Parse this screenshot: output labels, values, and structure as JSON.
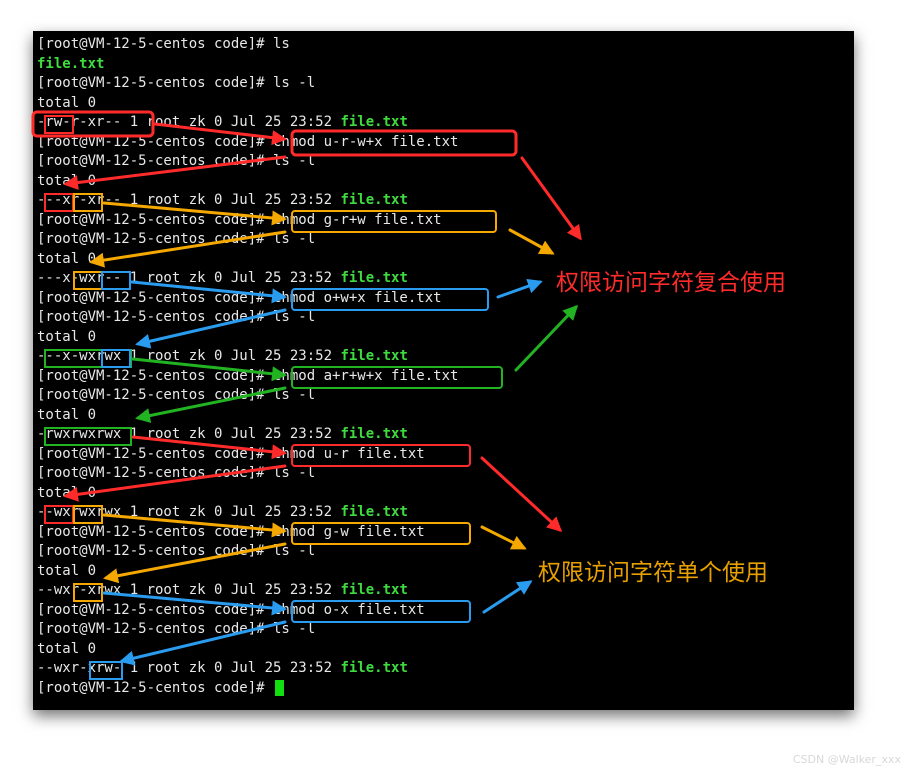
{
  "terminal": {
    "lines": [
      {
        "text": "[root@VM-12-5-centos code]# ls"
      },
      {
        "text": "",
        "file": "file.txt"
      },
      {
        "text": "[root@VM-12-5-centos code]# ls -l"
      },
      {
        "text": "total 0"
      },
      {
        "text": "-rw-r-xr-- 1 root zk 0 Jul 25 23:52 ",
        "file": "file.txt"
      },
      {
        "text": "[root@VM-12-5-centos code]# chmod u-r-w+x file.txt"
      },
      {
        "text": "[root@VM-12-5-centos code]# ls -l"
      },
      {
        "text": "total 0"
      },
      {
        "text": "---xr-xr-- 1 root zk 0 Jul 25 23:52 ",
        "file": "file.txt"
      },
      {
        "text": "[root@VM-12-5-centos code]# chmod g-r+w file.txt"
      },
      {
        "text": "[root@VM-12-5-centos code]# ls -l"
      },
      {
        "text": "total 0"
      },
      {
        "text": "---x-wxr-- 1 root zk 0 Jul 25 23:52 ",
        "file": "file.txt"
      },
      {
        "text": "[root@VM-12-5-centos code]# chmod o+w+x file.txt"
      },
      {
        "text": "[root@VM-12-5-centos code]# ls -l"
      },
      {
        "text": "total 0"
      },
      {
        "text": "---x-wxrwx 1 root zk 0 Jul 25 23:52 ",
        "file": "file.txt"
      },
      {
        "text": "[root@VM-12-5-centos code]# chmod a+r+w+x file.txt"
      },
      {
        "text": "[root@VM-12-5-centos code]# ls -l"
      },
      {
        "text": "total 0"
      },
      {
        "text": "-rwxrwxrwx 1 root zk 0 Jul 25 23:52 ",
        "file": "file.txt"
      },
      {
        "text": "[root@VM-12-5-centos code]# chmod u-r file.txt"
      },
      {
        "text": "[root@VM-12-5-centos code]# ls -l"
      },
      {
        "text": "total 0"
      },
      {
        "text": "--wxrwxrwx 1 root zk 0 Jul 25 23:52 ",
        "file": "file.txt"
      },
      {
        "text": "[root@VM-12-5-centos code]# chmod g-w file.txt"
      },
      {
        "text": "[root@VM-12-5-centos code]# ls -l"
      },
      {
        "text": "total 0"
      },
      {
        "text": "--wxr-xrwx 1 root zk 0 Jul 25 23:52 ",
        "file": "file.txt"
      },
      {
        "text": "[root@VM-12-5-centos code]# chmod o-x file.txt"
      },
      {
        "text": "[root@VM-12-5-centos code]# ls -l"
      },
      {
        "text": "total 0"
      },
      {
        "text": "--wxr-xrw- 1 root zk 0 Jul 25 23:52 ",
        "file": "file.txt"
      },
      {
        "text": "[root@VM-12-5-centos code]# ",
        "cursor": true
      }
    ]
  },
  "annotations": {
    "combined": "权限访问字符复合使用",
    "single": "权限访问字符单个使用"
  },
  "watermark": "CSDN @Walker_xxx",
  "colors": {
    "background": "#000000",
    "text": "#e8e8e8",
    "filename": "#3fdc3f",
    "cursor": "#10e010",
    "red": "#ff2b2b",
    "orange": "#f5a800",
    "blue": "#2a9cf0",
    "green": "#22b322"
  }
}
